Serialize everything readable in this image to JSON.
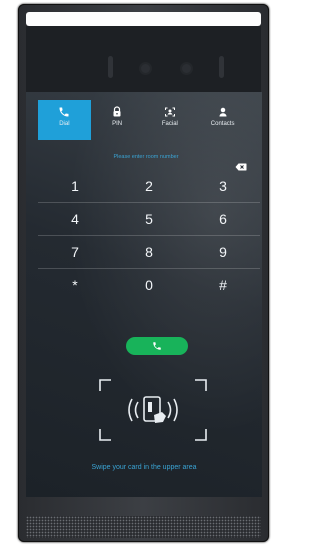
{
  "tabs": [
    {
      "label": "Dial",
      "icon": "phone-icon",
      "active": true
    },
    {
      "label": "PIN",
      "icon": "lock-icon",
      "active": false
    },
    {
      "label": "Facial",
      "icon": "face-scan-icon",
      "active": false
    },
    {
      "label": "Contacts",
      "icon": "person-icon",
      "active": false
    }
  ],
  "input": {
    "placeholder": "Please enter room number"
  },
  "keypad": [
    [
      "1",
      "2",
      "3"
    ],
    [
      "4",
      "5",
      "6"
    ],
    [
      "7",
      "8",
      "9"
    ],
    [
      "*",
      "0",
      "#"
    ]
  ],
  "card_reader": {
    "instruction": "Swipe your card in the upper area"
  },
  "colors": {
    "accent": "#1fa0d9",
    "call": "#18b35a",
    "prompt": "#3aa3d3"
  }
}
